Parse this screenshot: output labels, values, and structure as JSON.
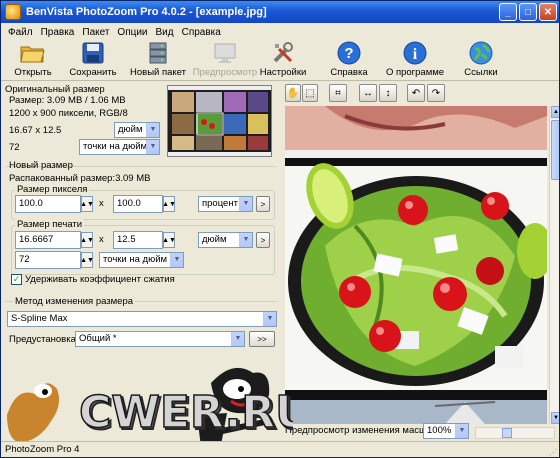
{
  "window": {
    "title": "BenVista PhotoZoom Pro 4.0.2 - [example.jpg]"
  },
  "menu": [
    "Файл",
    "Правка",
    "Пакет",
    "Опции",
    "Вид",
    "Справка"
  ],
  "toolbar": {
    "open": "Открыть",
    "save": "Сохранить",
    "new_batch": "Новый пакет",
    "preview": "Предпросмотр",
    "settings": "Настройки",
    "help": "Справка",
    "about": "О программе",
    "links": "Ссылки"
  },
  "original": {
    "title": "Оригинальный размер",
    "size": "Размер: 3.09 MB / 1.06 MB",
    "pixels": "1200 x 900 пиксели, RGB/8",
    "dims": "16.67 x 12.5",
    "units": "дюйм",
    "res": "72",
    "res_units": "точки на дюйм"
  },
  "newsize": {
    "title": "Новый размер",
    "unpacked": "Распакованный размер:3.09 MB",
    "pixel_title": "Размер пикселя",
    "px_w": "100.0",
    "px_h": "100.0",
    "x": "x",
    "px_units": "процент",
    "print_title": "Размер печати",
    "pr_w": "16.6667",
    "pr_h": "12.5",
    "pr_units": "дюйм",
    "pr_res": "72",
    "pr_res_units": "точки на дюйм",
    "keep_ratio": "Удерживать коэффициент сжатия",
    "more": ">"
  },
  "method": {
    "title": "Метод изменения размера",
    "value": "S-Spline Max",
    "preset_label": "Предустановка:",
    "preset_value": "Общий *",
    "preset_btn": ">>"
  },
  "preview_bar": {
    "label": "Предпросмотр изменения масштаба:",
    "zoom": "100%"
  },
  "status": "PhotoZoom Pro 4",
  "watermark": "CWER.RU"
}
